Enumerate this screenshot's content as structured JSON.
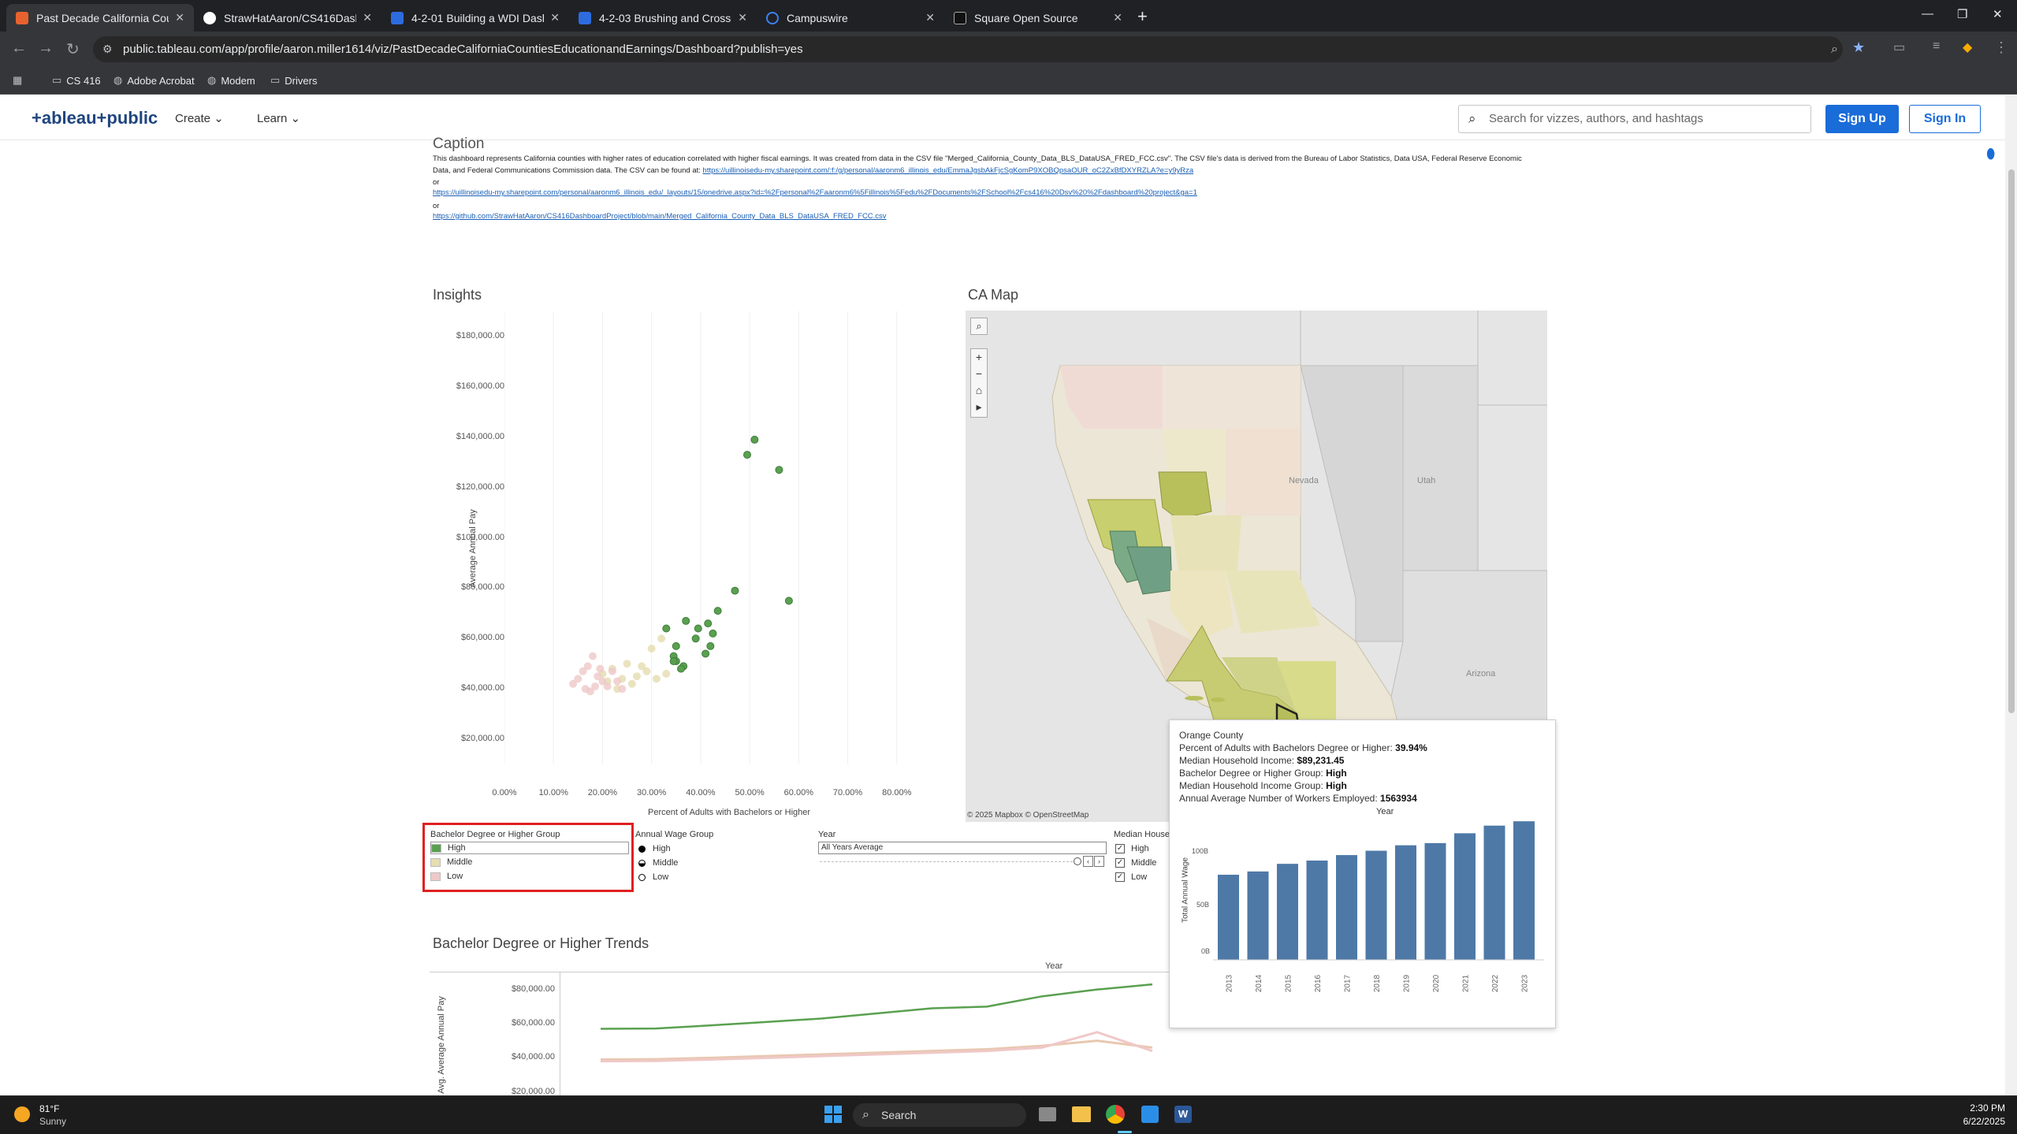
{
  "browser": {
    "tabs": [
      {
        "title": "Past Decade California Countie",
        "active": true,
        "favicon_color": "#e8622f"
      },
      {
        "title": "StrawHatAaron/CS416Dashboar",
        "active": false,
        "favicon_color": "#ffffff"
      },
      {
        "title": "4-2-01 Building a WDI Dashbo",
        "active": false,
        "favicon_color": "#2d6cdf"
      },
      {
        "title": "4-2-03 Brushing and Cross-Filt",
        "active": false,
        "favicon_color": "#2d6cdf"
      },
      {
        "title": "Campuswire",
        "active": false,
        "favicon_color": "#3b82f6"
      },
      {
        "title": "Square Open Source",
        "active": false,
        "favicon_color": "#111111"
      }
    ],
    "url": "public.tableau.com/app/profile/aaron.miller1614/viz/PastDecadeCaliforniaCountiesEducationandEarnings/Dashboard?publish=yes",
    "bookmarks": [
      "CS 416",
      "Adobe Acrobat",
      "Modem",
      "Drivers"
    ]
  },
  "tableau_header": {
    "logo": "+ableau+public",
    "nav": [
      "Create",
      "Learn"
    ],
    "search_placeholder": "Search for vizzes, authors, and hashtags",
    "sign_up": "Sign Up",
    "sign_in": "Sign In"
  },
  "caption": {
    "title": "Caption",
    "text": "This dashboard represents California counties with higher rates of education correlated with higher fiscal earnings. It was created from data in the CSV file \"Merged_California_County_Data_BLS_DataUSA_FRED_FCC.csv\". The CSV file's data is derived from the Bureau of Labor Statistics, Data USA, Federal Reserve Economic Data, and Federal Communications Commission data. The CSV can be found at:",
    "link1": "https://uillinoisedu-my.sharepoint.com/:f:/g/personal/aaronm6_illinois_edu/EmmaJgsbAkFjcSgKomP9XOBQpsaOUR_oC2ZxBfDXYRZLA?e=y9yRza",
    "or1": "or",
    "link2": "https://uillinoisedu-my.sharepoint.com/personal/aaronm6_illinois_edu/_layouts/15/onedrive.aspx?id=%2Fpersonal%2Faaronm6%5Fillinois%5Fedu%2FDocuments%2FSchool%2Fcs416%20Dsv%20%2Fdashboard%20project&ga=1",
    "or2": "or",
    "link3": "https://github.com/StrawHatAaron/CS416DashboardProject/blob/main/Merged_California_County_Data_BLS_DataUSA_FRED_FCC.csv"
  },
  "insights": {
    "title": "Insights",
    "y_axis_title": "Average Annual Pay",
    "x_axis_title": "Percent of Adults with Bachelors or Higher",
    "y_ticks": [
      "$180,000.00",
      "$160,000.00",
      "$140,000.00",
      "$120,000.00",
      "$100,000.00",
      "$80,000.00",
      "$60,000.00",
      "$40,000.00",
      "$20,000.00"
    ],
    "x_ticks": [
      "0.00%",
      "10.00%",
      "20.00%",
      "30.00%",
      "40.00%",
      "50.00%",
      "60.00%",
      "70.00%",
      "80.00%"
    ]
  },
  "chart_data": [
    {
      "type": "scatter",
      "title": "Insights",
      "xlabel": "Percent of Adults with Bachelors or Higher",
      "ylabel": "Average Annual Pay",
      "xlim": [
        0,
        90
      ],
      "ylim": [
        10000,
        190000
      ],
      "colors": {
        "High": "#5aa050",
        "Middle": "#e6ddb0",
        "Low": "#efc9c9"
      },
      "series": [
        {
          "name": "High",
          "x": [
            51,
            49.5,
            56,
            58,
            47,
            43.5,
            37,
            41.5,
            39.5,
            42.5,
            42,
            39,
            41,
            33,
            35,
            34.5,
            35,
            36.5,
            34.5,
            36
          ],
          "y": [
            139000,
            133000,
            127000,
            75000,
            79000,
            71000,
            67000,
            66000,
            64000,
            62000,
            57000,
            60000,
            54000,
            64000,
            57000,
            53000,
            51000,
            49000,
            51000,
            48000
          ]
        },
        {
          "name": "Middle",
          "x": [
            32,
            30,
            28,
            27,
            29,
            31,
            33,
            25,
            26,
            22,
            24,
            21,
            23,
            20
          ],
          "y": [
            60000,
            56000,
            49000,
            45000,
            47000,
            44000,
            46000,
            50000,
            42000,
            48000,
            44000,
            43000,
            40000,
            46000
          ]
        },
        {
          "name": "Low",
          "x": [
            18,
            17,
            16,
            19,
            20,
            18.5,
            16.5,
            15,
            22,
            21,
            14,
            17.5,
            19.5,
            23,
            24
          ],
          "y": [
            53000,
            49000,
            47000,
            45000,
            43000,
            41000,
            40000,
            44000,
            47000,
            41000,
            42000,
            39000,
            48000,
            43000,
            40000
          ]
        }
      ]
    },
    {
      "type": "bar",
      "title": "Orange County",
      "xlabel": "Year",
      "ylabel": "Total Annual Wage",
      "categories": [
        "2013",
        "2014",
        "2015",
        "2016",
        "2017",
        "2018",
        "2019",
        "2020",
        "2021",
        "2022",
        "2023"
      ],
      "values": [
        78,
        81,
        88,
        91,
        96,
        100,
        105,
        107,
        116,
        123,
        127
      ],
      "ylim": [
        0,
        130
      ],
      "color": "#4e79a7"
    },
    {
      "type": "line",
      "title": "Bachelor Degree or Higher Trends",
      "xlabel": "Year",
      "ylabel": "Avg. Average Annual Pay",
      "ylim": [
        18000,
        90000
      ],
      "series": [
        {
          "name": "High",
          "values": [
            57000,
            57200,
            59000,
            61000,
            63000,
            66000,
            69000,
            70000,
            76000,
            80000,
            83000
          ],
          "color": "#5aa050"
        },
        {
          "name": "Middle",
          "values": [
            39000,
            39200,
            40000,
            41000,
            42000,
            43000,
            44000,
            45000,
            47000,
            50000,
            46000
          ],
          "color": "#e8c8b0"
        },
        {
          "name": "Low",
          "values": [
            38000,
            38200,
            39000,
            40000,
            41000,
            42000,
            43000,
            44000,
            46000,
            55000,
            44000
          ],
          "color": "#f0c8c8"
        }
      ]
    }
  ],
  "ca_map": {
    "title": "CA Map",
    "labels": {
      "nevada": "Nevada",
      "utah": "Utah",
      "arizona": "Arizona"
    },
    "attribution": "© 2025 Mapbox © OpenStreetMap"
  },
  "legends": {
    "bachelor": {
      "title": "Bachelor Degree or Higher Group",
      "items": [
        "High",
        "Middle",
        "Low"
      ],
      "colors": [
        "#5aa050",
        "#e6ddb0",
        "#efc9c9"
      ]
    },
    "wage": {
      "title": "Annual Wage Group",
      "items": [
        "High",
        "Middle",
        "Low"
      ]
    },
    "year": {
      "title": "Year",
      "value": "All Years Average"
    },
    "median": {
      "title": "Median House",
      "items": [
        "High",
        "Middle",
        "Low"
      ]
    },
    "highlight_color": "#e02020"
  },
  "tooltip": {
    "county": "Orange County",
    "line1_label": "Percent of Adults with Bachelors Degree or Higher: ",
    "line1_value": "39.94%",
    "line2_label": "Median Household Income: ",
    "line2_value": "$89,231.45",
    "line3_label": "Bachelor Degree or Higher Group: ",
    "line3_value": "High",
    "line4_label": "Median Household Income Group: ",
    "line4_value": "High",
    "line5_label": "Annual Average Number of Workers Employed: ",
    "line5_value": "1563934",
    "chart_header": "Year",
    "y_title": "Total Annual Wage",
    "y_ticks": [
      "100B",
      "50B",
      "0B"
    ]
  },
  "trends": {
    "title": "Bachelor Degree or Higher Trends",
    "year_header": "Year",
    "y_title": "Avg. Average Annual Pay",
    "y_ticks": [
      "$80,000.00",
      "$60,000.00",
      "$40,000.00",
      "$20,000.00"
    ]
  },
  "taskbar": {
    "weather_temp": "81°F",
    "weather_desc": "Sunny",
    "search": "Search",
    "time": "2:30 PM",
    "date": "6/22/2025"
  }
}
